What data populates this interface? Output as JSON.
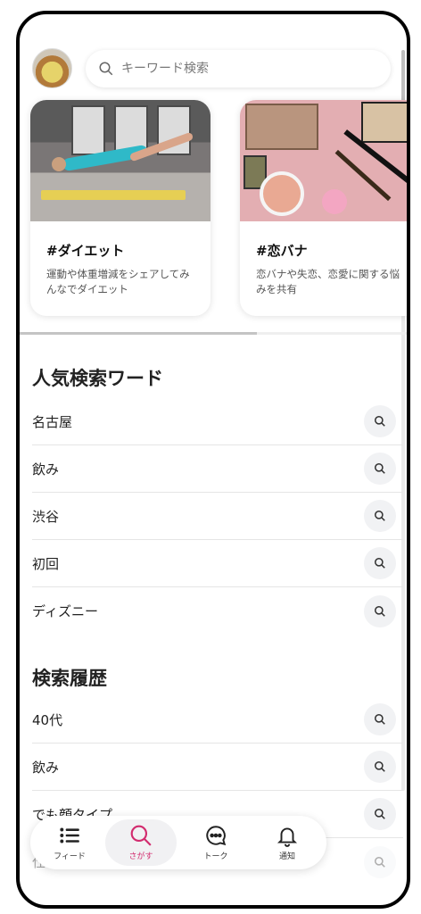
{
  "search": {
    "placeholder": "キーワード検索"
  },
  "cards": [
    {
      "title": "#ダイエット",
      "description": "運動や体重増減をシェアしてみんなでダイエット"
    },
    {
      "title": "#恋バナ",
      "description": "恋バナや失恋、恋愛に関する悩みを共有"
    }
  ],
  "popular": {
    "heading": "人気検索ワード",
    "items": [
      "名古屋",
      "飲み",
      "渋谷",
      "初回",
      "ディズニー"
    ]
  },
  "history": {
    "heading": "検索履歴",
    "items": [
      "40代",
      "飲み",
      "でも顔タイプ",
      "仕"
    ]
  },
  "tabbar": {
    "tabs": [
      {
        "label": "フィード",
        "icon": "list-icon"
      },
      {
        "label": "さがす",
        "icon": "search-icon",
        "active": true
      },
      {
        "label": "トーク",
        "icon": "chat-bubble-icon"
      },
      {
        "label": "通知",
        "icon": "bell-icon"
      }
    ]
  },
  "colors": {
    "accent": "#d22b6e",
    "chip_bg": "#f1f2f4",
    "divider": "#e5e5e5"
  }
}
